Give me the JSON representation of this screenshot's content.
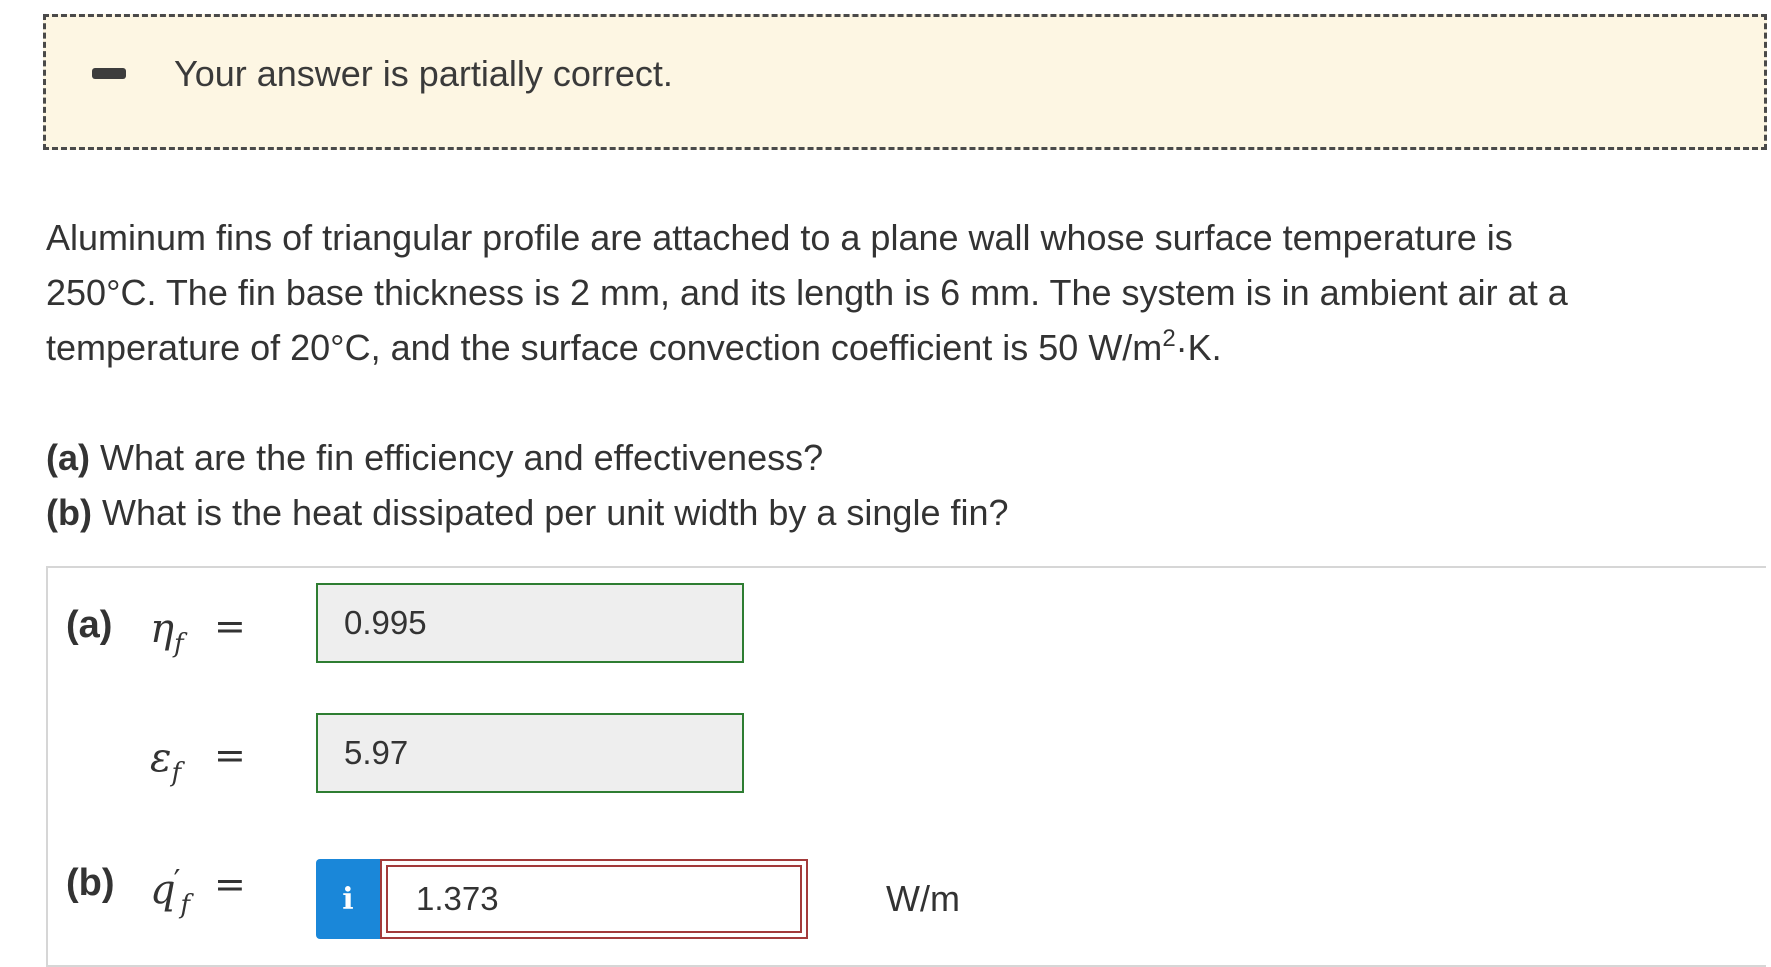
{
  "feedback": {
    "message": "Your answer is partially correct.",
    "status_color": "#fdf6e3",
    "icon": "minus-icon"
  },
  "problem": {
    "line1": "Aluminum fins of triangular profile are attached to a plane wall whose surface temperature is",
    "line2": "250°C. The fin base thickness is 2 mm, and its length is 6 mm. The system is in ambient air at a",
    "line3_pre": "temperature of 20°C, and the surface convection coefficient is 50 W/m",
    "line3_sup": "2",
    "line3_post": "·K."
  },
  "questions": [
    {
      "label": "(a)",
      "text": "What are the fin efficiency and effectiveness?"
    },
    {
      "label": "(b)",
      "text": "What is the heat dissipated per unit width by a single fin?"
    }
  ],
  "answers": {
    "part_a_label": "(a)",
    "part_b_label": "(b)",
    "eta": {
      "symbol": "η",
      "sub": "f",
      "eq": "=",
      "value": "0.995",
      "status": "correct"
    },
    "eps": {
      "symbol": "ε",
      "sub": "f",
      "eq": "=",
      "value": "5.97",
      "status": "correct"
    },
    "q": {
      "symbol": "q",
      "prime": "′",
      "sub": "f",
      "eq": "=",
      "value": "1.373",
      "status": "incorrect",
      "unit": "W/m",
      "info_icon": "info-icon",
      "info_glyph": "i"
    }
  },
  "colors": {
    "correct_border": "#2e7d32",
    "incorrect_border": "#a33a3a",
    "info_button": "#1a87d9"
  }
}
